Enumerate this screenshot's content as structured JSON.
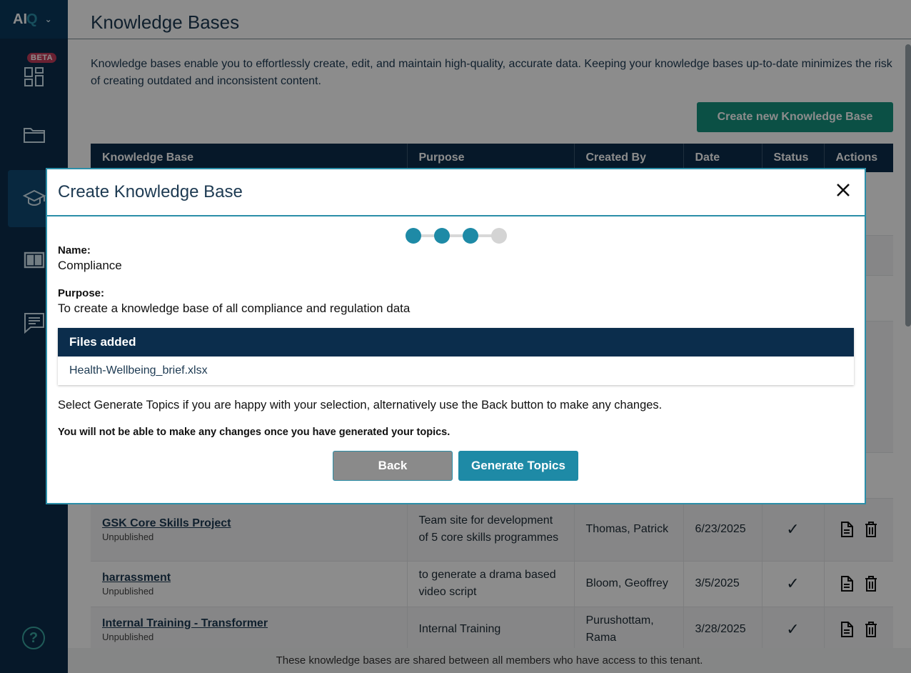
{
  "app": {
    "logo_text": "AI",
    "logo_q": "Q"
  },
  "sidebar": {
    "beta_badge": "BETA",
    "items": [
      {
        "icon": "dashboard-icon"
      },
      {
        "icon": "folder-icon"
      },
      {
        "icon": "graduation-cap-icon",
        "active": true
      },
      {
        "icon": "book-icon"
      },
      {
        "icon": "chat-icon"
      }
    ],
    "help_glyph": "?"
  },
  "page": {
    "title": "Knowledge Bases",
    "intro": "Knowledge bases enable you to effortlessly create, edit, and maintain high-quality, accurate data. Keeping your knowledge bases up-to-date minimizes the risk of creating outdated and inconsistent content.",
    "create_button": "Create new Knowledge Base",
    "footer": "These knowledge bases are shared between all members who have access to this tenant."
  },
  "table": {
    "headers": [
      "Knowledge Base",
      "Purpose",
      "Created By",
      "Date",
      "Status",
      "Actions"
    ],
    "rows": [
      {
        "name": "GSK Core Skills Project",
        "state": "Unpublished",
        "purpose": "Team site for development of 5 core skills programmes",
        "created_by": "Thomas, Patrick",
        "date": "6/23/2025"
      },
      {
        "name": "harrassment",
        "state": "Unpublished",
        "purpose": "to generate a drama based video script",
        "created_by": "Bloom, Geoffrey",
        "date": "3/5/2025"
      },
      {
        "name": "Internal Training - Transformer",
        "state": "Unpublished",
        "purpose": "Internal Training",
        "created_by": "Purushottam, Rama",
        "date": "3/28/2025"
      }
    ]
  },
  "modal": {
    "title": "Create Knowledge Base",
    "steps_total": 4,
    "steps_completed": 3,
    "name_label": "Name:",
    "name_value": "Compliance",
    "purpose_label": "Purpose:",
    "purpose_value": "To create a knowledge base of all compliance and regulation data",
    "files_header": "Files added",
    "files": [
      "Health-Wellbeing_brief.xlsx"
    ],
    "note": "Select Generate Topics if you are happy with your selection, alternatively use the Back button to make any changes.",
    "warning": "You will not be able to make any changes once you have generated your topics.",
    "back_button": "Back",
    "generate_button": "Generate Topics"
  },
  "colors": {
    "sidebar": "#0b2d4c",
    "accent_teal": "#15927e",
    "accent_blue": "#1e8aa6",
    "check": "#15927e"
  }
}
